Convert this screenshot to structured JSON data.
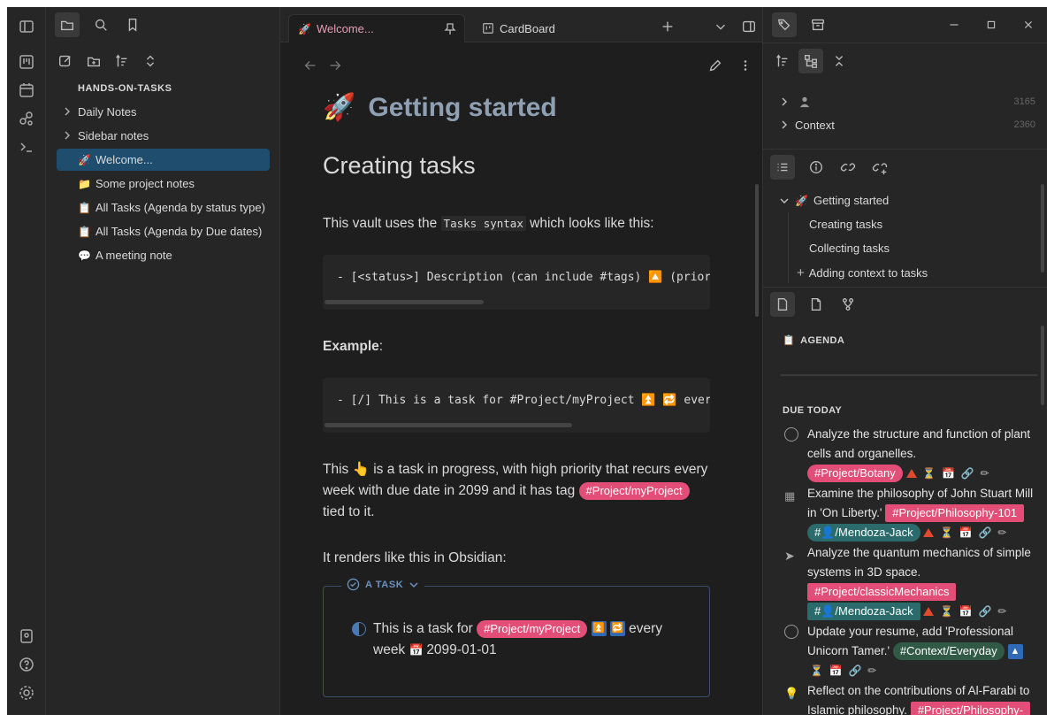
{
  "files": {
    "vault_name": "HANDS-ON-TASKS",
    "items": [
      {
        "label": "Daily Notes",
        "icon": "",
        "folder": true
      },
      {
        "label": "Sidebar notes",
        "icon": "",
        "folder": true
      },
      {
        "label": "Welcome...",
        "icon": "🚀",
        "selected": true
      },
      {
        "label": "Some project notes",
        "icon": "📁"
      },
      {
        "label": "All Tasks (Agenda by status type)",
        "icon": "📋"
      },
      {
        "label": "All Tasks (Agenda by Due dates)",
        "icon": "📋"
      },
      {
        "label": "A meeting note",
        "icon": "💬"
      }
    ]
  },
  "tabs": {
    "active": {
      "label": "Welcome...",
      "icon": "🚀"
    },
    "second": {
      "label": "CardBoard"
    }
  },
  "doc": {
    "title_icon": "🚀",
    "title": "Getting started",
    "h2": "Creating tasks",
    "p1_a": "This vault uses the ",
    "p1_code": "Tasks syntax",
    "p1_b": " which looks like this:",
    "code1": "- [<status>] Description (can include #tags) 🔼 (priori",
    "example_label": "Example",
    "example_colon": ":",
    "code2": "- [/] This is a task for #Project/myProject ⏫ 🔁 ever",
    "p2_a": "This ",
    "p2_icon": "👆",
    "p2_b": " is a task in progress, with high priority that recurs every week with due date in 2099 and it has tag ",
    "p2_tag": "#Project/myProject",
    "p2_c": " tied to it.",
    "p3": "It renders like this in Obsidian:",
    "callout_title": "A TASK",
    "callout_text_a": "This is a task for ",
    "callout_tag": "#Project/myProject",
    "callout_text_b": " every week ",
    "callout_date": "2099-01-01"
  },
  "right": {
    "rows": [
      {
        "label": "",
        "count": "3165"
      },
      {
        "label": "Context",
        "count": "2360"
      }
    ],
    "toc": {
      "root": "Getting started",
      "root_icon": "🚀",
      "items": [
        "Creating tasks",
        "Collecting tasks",
        "Adding context to tasks"
      ]
    },
    "agenda_title": "AGENDA",
    "due_title": "DUE TODAY",
    "tasks": [
      {
        "text": "Analyze the structure and function of plant cells and organelles.",
        "tags": [
          "#Project/Botany"
        ]
      },
      {
        "text": "Examine the philosophy of John Stuart Mill in 'On Liberty.'",
        "tags": [
          "#Project/Philosophy-101",
          "#👤/Mendoza-Jack"
        ]
      },
      {
        "text": "Analyze the quantum mechanics of simple systems in 3D space.",
        "tags": [
          "#Project/classicMechanics",
          "#👤/Mendoza-Jack"
        ]
      },
      {
        "text": "Update your resume, add 'Professional Unicorn Tamer.'",
        "tags": [
          "#Context/Everyday"
        ]
      },
      {
        "text": "Reflect on the contributions of Al-Farabi to Islamic philosophy.",
        "tags": [
          "#Project/Philosophy-"
        ]
      }
    ]
  },
  "colors": {
    "accent": "#e24e77",
    "selected": "#1e4d6e",
    "teal_tag": "#2b6b6b"
  }
}
